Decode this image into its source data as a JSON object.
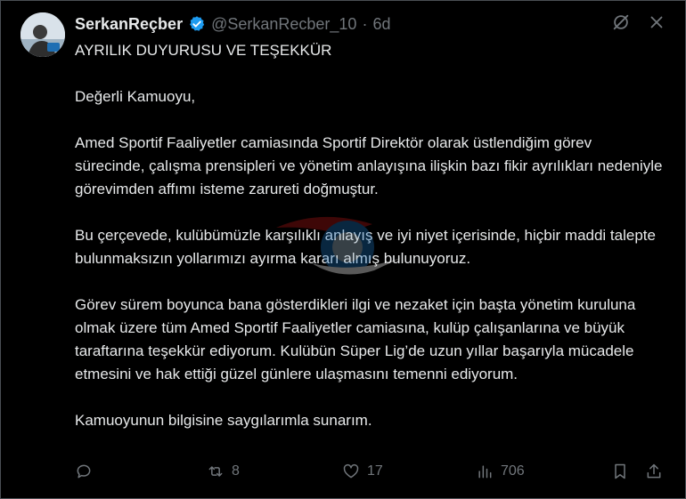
{
  "author": {
    "display_name": "SerkanReçber",
    "handle": "@SerkanRecber_10",
    "separator": "·",
    "time": "6d"
  },
  "tweet": {
    "title": "AYRILIK DUYURUSU VE TEŞEKKÜR",
    "paragraphs": [
      "Değerli Kamuoyu,",
      "Amed Sportif Faaliyetler camiasında Sportif Direktör olarak üstlendiğim görev sürecinde, çalışma prensipleri ve yönetim anlayışına ilişkin bazı fikir ayrılıkları nedeniyle görevimden affımı isteme zarureti doğmuştur.",
      "Bu çerçevede, kulübümüzle karşılıklı anlayış ve iyi niyet içerisinde, hiçbir maddi talepte bulunmaksızın yollarımızı ayırma kararı almış bulunuyoruz.",
      "Görev sürem boyunca bana gösterdikleri ilgi ve nezaket için başta yönetim kuruluna olmak üzere tüm Amed Sportif Faaliyetler camiasına, kulüp çalışanlarına ve büyük taraftarına teşekkür ediyorum. Kulübün Süper Lig’de uzun yıllar başarıyla mücadele etmesini ve hak ettiği güzel günlere ulaşmasını temenni ediyorum.",
      "Kamuoyunun bilgisine saygılarımla sunarım."
    ]
  },
  "actions": {
    "reply_count": "",
    "retweet_count": "8",
    "like_count": "17",
    "views_count": "706"
  },
  "icons": {
    "verified": "verified-badge-icon",
    "grok": "grok-icon",
    "more": "more-options-icon",
    "reply": "reply-icon",
    "retweet": "retweet-icon",
    "like": "like-icon",
    "views": "views-icon",
    "bookmark": "bookmark-icon",
    "share": "share-icon"
  },
  "colors": {
    "background": "#000000",
    "text": "#e7e9ea",
    "muted": "#71767b",
    "verified": "#1d9bf0"
  }
}
